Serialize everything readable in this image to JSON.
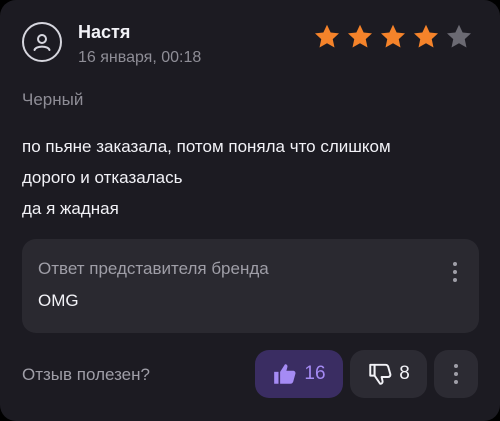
{
  "review": {
    "author": "Настя",
    "date": "16 января, 00:18",
    "rating": 4,
    "rating_max": 5,
    "variant": "Черный",
    "text_lines": [
      "по пьяне заказала, потом поняла что слишком",
      "дорого и отказалась",
      "да я жадная"
    ]
  },
  "brand_reply": {
    "title": "Ответ представителя бренда",
    "text": "OMG"
  },
  "footer": {
    "helpful_label": "Отзыв полезен?",
    "likes": "16",
    "dislikes": "8"
  },
  "colors": {
    "star_filled": "#f5832a",
    "star_empty": "#6b6a73",
    "like_accent": "#a58bf4",
    "like_bg": "#3a2d62"
  },
  "icons": [
    "user-icon",
    "star-icon",
    "thumbs-up-icon",
    "thumbs-down-icon",
    "more-vertical-icon"
  ]
}
